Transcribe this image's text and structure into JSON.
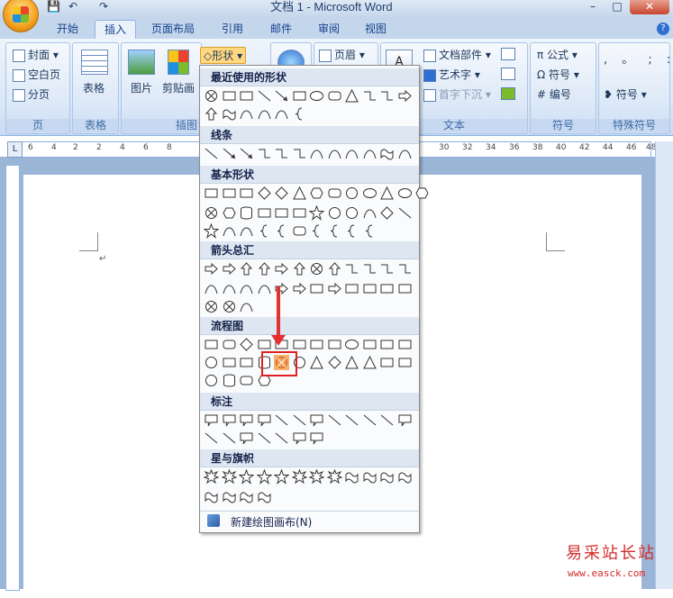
{
  "window": {
    "title": "文档 1 - Microsoft Word",
    "minimize": "–",
    "maximize": "□",
    "close": "✕"
  },
  "tabs": [
    {
      "label": "开始"
    },
    {
      "label": "插入"
    },
    {
      "label": "页面布局"
    },
    {
      "label": "引用"
    },
    {
      "label": "邮件"
    },
    {
      "label": "审阅"
    },
    {
      "label": "视图"
    }
  ],
  "ribbon": {
    "pages": {
      "cover": "封面",
      "blank": "空白页",
      "break": "分页",
      "label": "页"
    },
    "tables": {
      "table": "表格",
      "label": "表格"
    },
    "illustrations": {
      "picture": "图片",
      "clipart": "剪贴画",
      "shapes": "形状",
      "label": "插图"
    },
    "header": {
      "header": "页眉"
    },
    "text": {
      "parts": "文档部件",
      "wordart": "艺术字",
      "dropcap": "首字下沉",
      "label": "文本"
    },
    "symbols": {
      "formula": "公式",
      "symbol": "符号",
      "number": "编号",
      "label": "符号"
    },
    "special": {
      "symbol": "符号",
      "chars": ", 。 ; : ?",
      "label": "特殊符号"
    }
  },
  "shapes_menu": {
    "sections": [
      {
        "title": "最近使用的形状"
      },
      {
        "title": "线条"
      },
      {
        "title": "基本形状"
      },
      {
        "title": "箭头总汇"
      },
      {
        "title": "流程图"
      },
      {
        "title": "标注"
      },
      {
        "title": "星与旗帜"
      }
    ],
    "new_canvas": "新建绘图画布(N)"
  },
  "ruler": {
    "h_ticks": [
      "6",
      "4",
      "2",
      "2",
      "4",
      "6",
      "8",
      "30",
      "32",
      "34",
      "36",
      "38",
      "40",
      "42",
      "44",
      "46",
      "48"
    ]
  },
  "watermark": {
    "cn": "易采站长站",
    "url": "www.easck.com"
  }
}
